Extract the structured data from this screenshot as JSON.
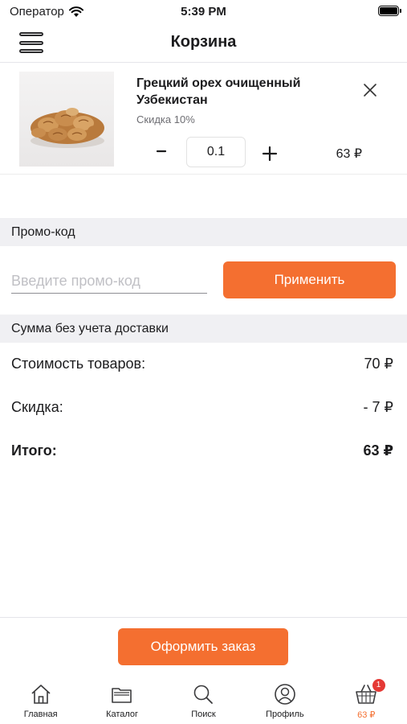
{
  "status_bar": {
    "carrier": "Оператор",
    "time": "5:39 PM"
  },
  "nav": {
    "title": "Корзина",
    "menu_icon": "hamburger-menu-icon"
  },
  "cart": {
    "items": [
      {
        "name": "Грецкий орех очищенный Узбекистан",
        "discount": "Скидка 10%",
        "quantity": "0.1",
        "price": "63 ₽",
        "minus_label": "-",
        "image": "walnut-product-image"
      }
    ]
  },
  "promo": {
    "header": "Промо-код",
    "placeholder": "Введите промо-код",
    "value": "",
    "apply_label": "Применить"
  },
  "summary": {
    "header": "Сумма без учета доставки",
    "rows": [
      {
        "label": "Стоимость товаров:",
        "value": "70 ₽"
      },
      {
        "label": "Скидка:",
        "value": "- 7 ₽"
      },
      {
        "label": "Итого:",
        "value": "63 ₽"
      }
    ]
  },
  "checkout": {
    "label": "Оформить заказ"
  },
  "tab_bar": {
    "tabs": [
      {
        "label": "Главная",
        "icon": "home-icon"
      },
      {
        "label": "Каталог",
        "icon": "folder-icon"
      },
      {
        "label": "Поиск",
        "icon": "search-icon"
      },
      {
        "label": "Профиль",
        "icon": "profile-icon"
      },
      {
        "label": "63 ₽",
        "icon": "basket-icon",
        "badge": "1",
        "active": true
      }
    ]
  },
  "colors": {
    "accent": "#f46f30",
    "badge": "#e53935",
    "section_bg": "#f0f0f3"
  }
}
